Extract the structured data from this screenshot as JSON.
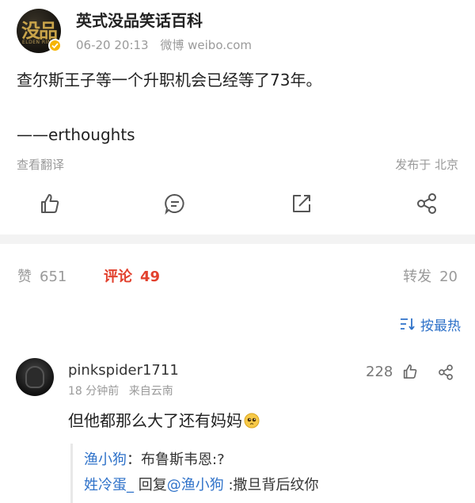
{
  "post": {
    "author": "英式没品笑话百科",
    "avatar_text": "没品",
    "avatar_subtext": "ELDEN RING",
    "time": "06-20 20:13",
    "source": "微博 weibo.com",
    "text": "查尔斯王子等一个升职机会已经等了73年。",
    "signature": "——erthoughts",
    "translate_label": "查看翻译",
    "location": "发布于 北京",
    "actions": [
      "like-icon",
      "comment-icon",
      "repost-icon",
      "share-icon"
    ]
  },
  "stats": {
    "likes_label": "赞",
    "likes_count": "651",
    "comments_label": "评论",
    "comments_count": "49",
    "reposts_label": "转发",
    "reposts_count": "20"
  },
  "sort": {
    "label": "按最热",
    "icon": "sort-icon"
  },
  "comment": {
    "user": "pinkspider1711",
    "time": "18 分钟前",
    "source": "来自云南",
    "likes": "228",
    "text": "但他都那么大了还有妈妈",
    "emoji": "pleading-face-emoji",
    "replies": [
      {
        "user": "渔小狗",
        "sep": "：",
        "text": "布鲁斯韦恩:?"
      },
      {
        "user": "姓冷蛋_",
        "reply_word": " 回复",
        "target": "@渔小狗",
        "text": " :撒旦背后纹你"
      }
    ]
  },
  "colors": {
    "accent_red": "#e2412e",
    "link_blue": "#2f72c9",
    "muted_gray": "#9a9a9a",
    "verified_gold": "#f6b400"
  }
}
